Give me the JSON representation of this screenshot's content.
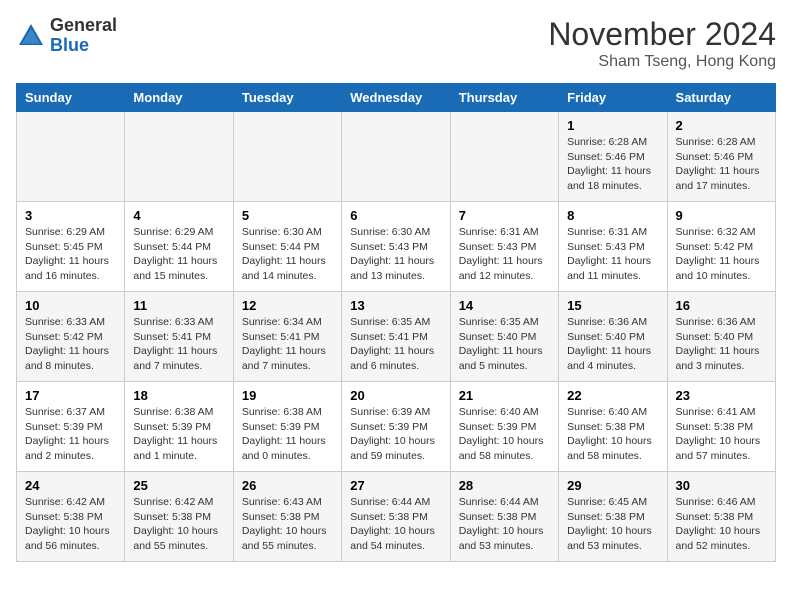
{
  "header": {
    "logo_general": "General",
    "logo_blue": "Blue",
    "month_title": "November 2024",
    "location": "Sham Tseng, Hong Kong"
  },
  "days_of_week": [
    "Sunday",
    "Monday",
    "Tuesday",
    "Wednesday",
    "Thursday",
    "Friday",
    "Saturday"
  ],
  "weeks": [
    [
      {
        "day": "",
        "info": ""
      },
      {
        "day": "",
        "info": ""
      },
      {
        "day": "",
        "info": ""
      },
      {
        "day": "",
        "info": ""
      },
      {
        "day": "",
        "info": ""
      },
      {
        "day": "1",
        "info": "Sunrise: 6:28 AM\nSunset: 5:46 PM\nDaylight: 11 hours and 18 minutes."
      },
      {
        "day": "2",
        "info": "Sunrise: 6:28 AM\nSunset: 5:46 PM\nDaylight: 11 hours and 17 minutes."
      }
    ],
    [
      {
        "day": "3",
        "info": "Sunrise: 6:29 AM\nSunset: 5:45 PM\nDaylight: 11 hours and 16 minutes."
      },
      {
        "day": "4",
        "info": "Sunrise: 6:29 AM\nSunset: 5:44 PM\nDaylight: 11 hours and 15 minutes."
      },
      {
        "day": "5",
        "info": "Sunrise: 6:30 AM\nSunset: 5:44 PM\nDaylight: 11 hours and 14 minutes."
      },
      {
        "day": "6",
        "info": "Sunrise: 6:30 AM\nSunset: 5:43 PM\nDaylight: 11 hours and 13 minutes."
      },
      {
        "day": "7",
        "info": "Sunrise: 6:31 AM\nSunset: 5:43 PM\nDaylight: 11 hours and 12 minutes."
      },
      {
        "day": "8",
        "info": "Sunrise: 6:31 AM\nSunset: 5:43 PM\nDaylight: 11 hours and 11 minutes."
      },
      {
        "day": "9",
        "info": "Sunrise: 6:32 AM\nSunset: 5:42 PM\nDaylight: 11 hours and 10 minutes."
      }
    ],
    [
      {
        "day": "10",
        "info": "Sunrise: 6:33 AM\nSunset: 5:42 PM\nDaylight: 11 hours and 8 minutes."
      },
      {
        "day": "11",
        "info": "Sunrise: 6:33 AM\nSunset: 5:41 PM\nDaylight: 11 hours and 7 minutes."
      },
      {
        "day": "12",
        "info": "Sunrise: 6:34 AM\nSunset: 5:41 PM\nDaylight: 11 hours and 7 minutes."
      },
      {
        "day": "13",
        "info": "Sunrise: 6:35 AM\nSunset: 5:41 PM\nDaylight: 11 hours and 6 minutes."
      },
      {
        "day": "14",
        "info": "Sunrise: 6:35 AM\nSunset: 5:40 PM\nDaylight: 11 hours and 5 minutes."
      },
      {
        "day": "15",
        "info": "Sunrise: 6:36 AM\nSunset: 5:40 PM\nDaylight: 11 hours and 4 minutes."
      },
      {
        "day": "16",
        "info": "Sunrise: 6:36 AM\nSunset: 5:40 PM\nDaylight: 11 hours and 3 minutes."
      }
    ],
    [
      {
        "day": "17",
        "info": "Sunrise: 6:37 AM\nSunset: 5:39 PM\nDaylight: 11 hours and 2 minutes."
      },
      {
        "day": "18",
        "info": "Sunrise: 6:38 AM\nSunset: 5:39 PM\nDaylight: 11 hours and 1 minute."
      },
      {
        "day": "19",
        "info": "Sunrise: 6:38 AM\nSunset: 5:39 PM\nDaylight: 11 hours and 0 minutes."
      },
      {
        "day": "20",
        "info": "Sunrise: 6:39 AM\nSunset: 5:39 PM\nDaylight: 10 hours and 59 minutes."
      },
      {
        "day": "21",
        "info": "Sunrise: 6:40 AM\nSunset: 5:39 PM\nDaylight: 10 hours and 58 minutes."
      },
      {
        "day": "22",
        "info": "Sunrise: 6:40 AM\nSunset: 5:38 PM\nDaylight: 10 hours and 58 minutes."
      },
      {
        "day": "23",
        "info": "Sunrise: 6:41 AM\nSunset: 5:38 PM\nDaylight: 10 hours and 57 minutes."
      }
    ],
    [
      {
        "day": "24",
        "info": "Sunrise: 6:42 AM\nSunset: 5:38 PM\nDaylight: 10 hours and 56 minutes."
      },
      {
        "day": "25",
        "info": "Sunrise: 6:42 AM\nSunset: 5:38 PM\nDaylight: 10 hours and 55 minutes."
      },
      {
        "day": "26",
        "info": "Sunrise: 6:43 AM\nSunset: 5:38 PM\nDaylight: 10 hours and 55 minutes."
      },
      {
        "day": "27",
        "info": "Sunrise: 6:44 AM\nSunset: 5:38 PM\nDaylight: 10 hours and 54 minutes."
      },
      {
        "day": "28",
        "info": "Sunrise: 6:44 AM\nSunset: 5:38 PM\nDaylight: 10 hours and 53 minutes."
      },
      {
        "day": "29",
        "info": "Sunrise: 6:45 AM\nSunset: 5:38 PM\nDaylight: 10 hours and 53 minutes."
      },
      {
        "day": "30",
        "info": "Sunrise: 6:46 AM\nSunset: 5:38 PM\nDaylight: 10 hours and 52 minutes."
      }
    ]
  ]
}
